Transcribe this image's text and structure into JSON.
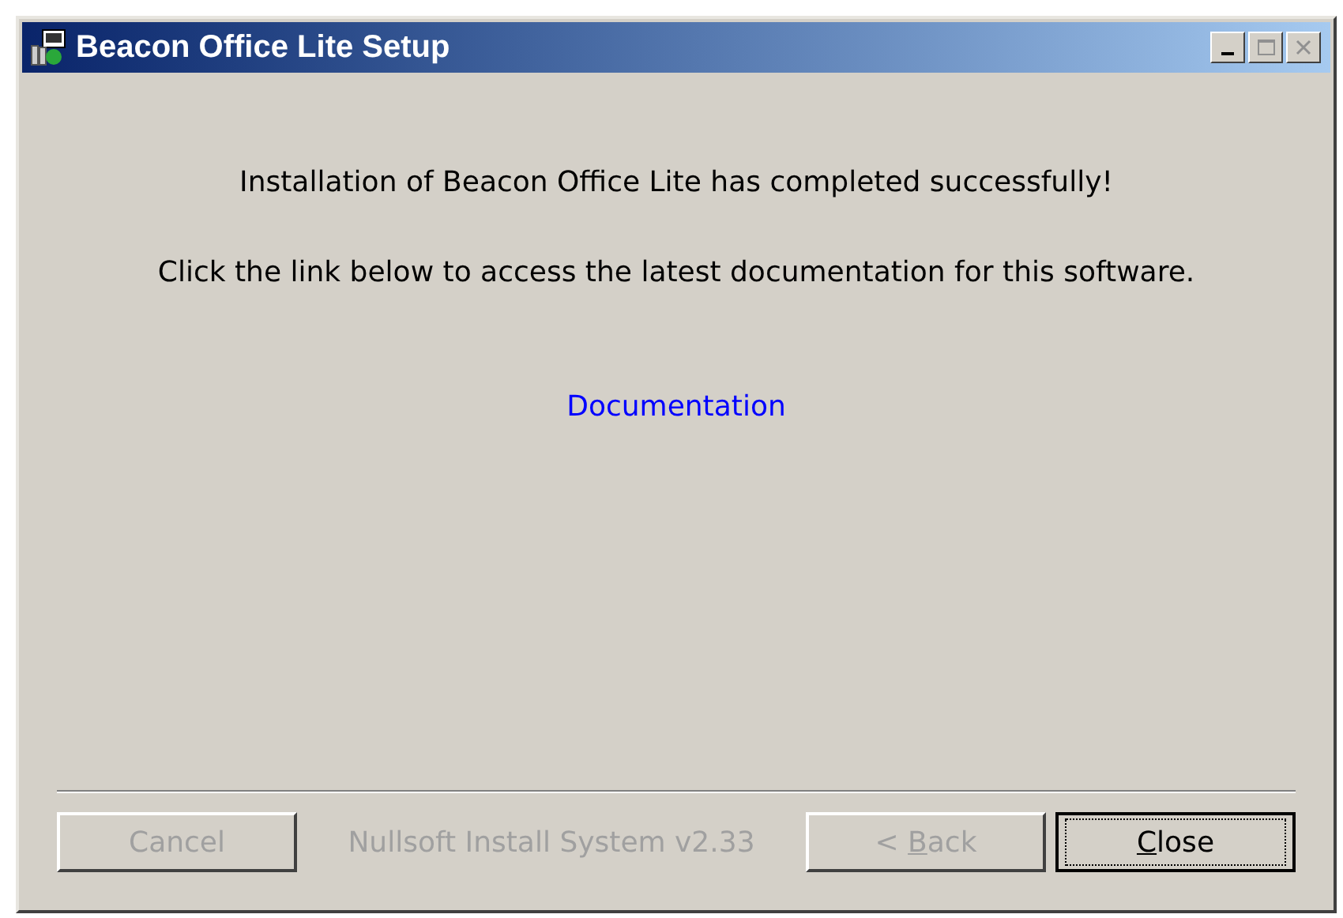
{
  "window": {
    "title": "Beacon Office Lite Setup"
  },
  "messages": [
    "Installation of Beacon Office Lite has completed successfully!",
    "Click the link below to access the latest documentation for this software."
  ],
  "link": {
    "label": "Documentation"
  },
  "branding": "Nullsoft Install System v2.33",
  "buttons": [
    {
      "before": "Cancel",
      "disabled": true,
      "default": false
    },
    {
      "before": "< ",
      "mnemonic": "B",
      "after": "ack",
      "disabled": true,
      "default": false
    },
    {
      "mnemonic": "C",
      "after": "lose",
      "disabled": false,
      "default": true
    }
  ]
}
